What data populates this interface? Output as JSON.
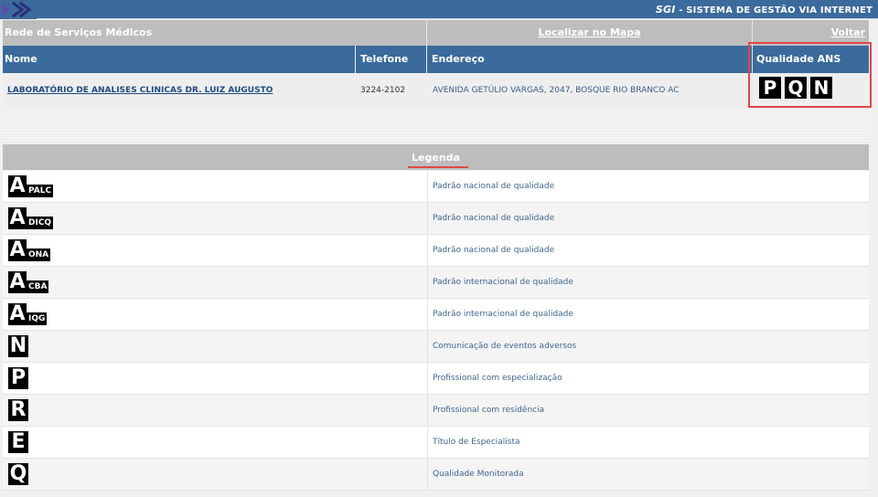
{
  "topbar": {
    "brand_short": "SGI",
    "brand_long": " - SISTEMA DE GESTÃO VIA INTERNET"
  },
  "header": {
    "section_title": "Rede de Serviços Médicos",
    "map_link": "Localizar no Mapa",
    "back_link": "Voltar"
  },
  "table": {
    "columns": [
      "Nome",
      "Telefone",
      "Endereço",
      "Qualidade ANS"
    ],
    "row": {
      "name": "LABORATÓRIO DE ANALISES CLINICAS DR. LUIZ AUGUSTO",
      "phone": "3224-2102",
      "address": "AVENIDA GETÚLIO VARGAS, 2047, BOSQUE RIO BRANCO AC",
      "quality_badges": [
        "P",
        "Q",
        "N"
      ]
    }
  },
  "legend": {
    "title": "Legenda",
    "items": [
      {
        "letter": "A",
        "sub": "PALC",
        "desc": "Padrão nacional de qualidade"
      },
      {
        "letter": "A",
        "sub": "DICQ",
        "desc": "Padrão nacional de qualidade"
      },
      {
        "letter": "A",
        "sub": "ONA",
        "desc": "Padrão nacional de qualidade"
      },
      {
        "letter": "A",
        "sub": "CBA",
        "desc": "Padrão internacional de qualidade"
      },
      {
        "letter": "A",
        "sub": "IQG",
        "desc": "Padrão internacional de qualidade"
      },
      {
        "letter": "N",
        "sub": "",
        "desc": "Comunicação de eventos adversos"
      },
      {
        "letter": "P",
        "sub": "",
        "desc": "Profissional com especialização"
      },
      {
        "letter": "R",
        "sub": "",
        "desc": "Profissional com residência"
      },
      {
        "letter": "E",
        "sub": "",
        "desc": "Título de Especialista"
      },
      {
        "letter": "Q",
        "sub": "",
        "desc": "Qualidade Monitorada"
      }
    ]
  },
  "colors": {
    "primary_blue": "#3b6a9c",
    "header_gray": "#bdbdbd",
    "highlight_red": "#e04848"
  }
}
